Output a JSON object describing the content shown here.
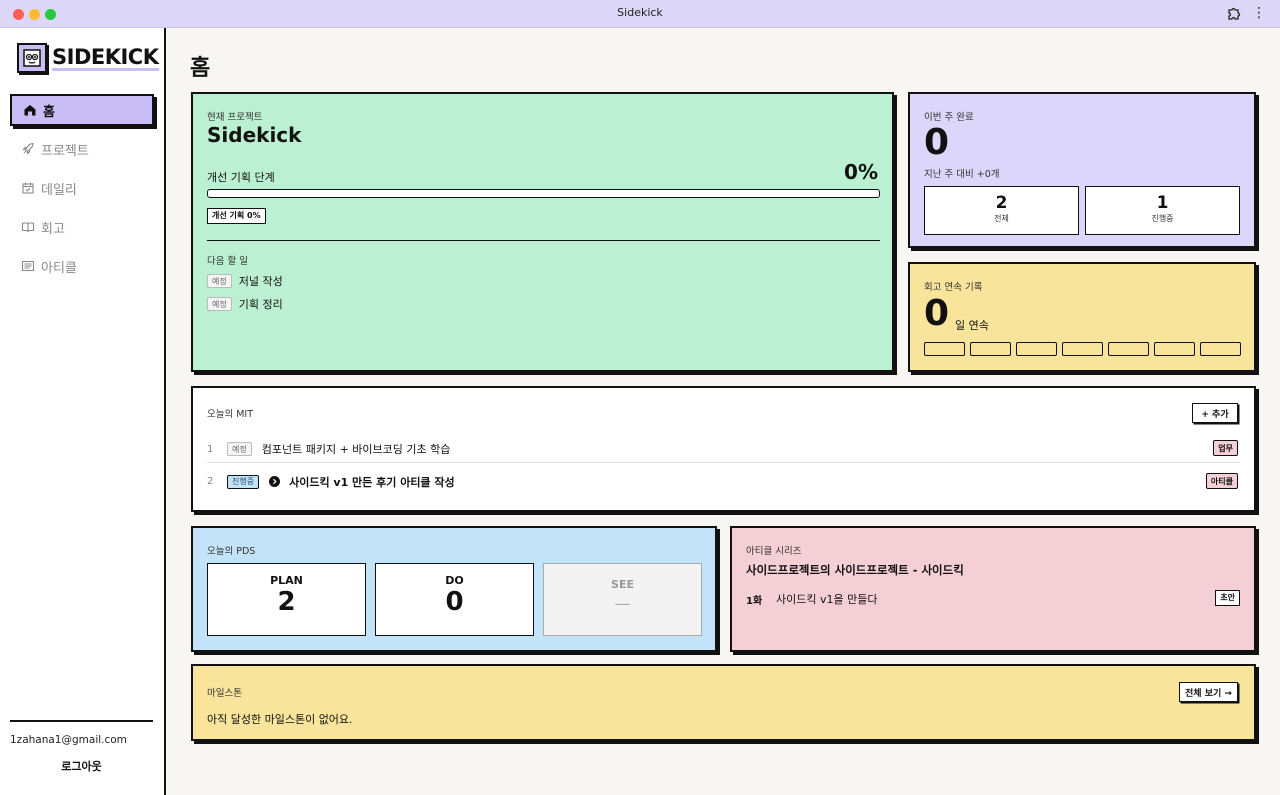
{
  "window": {
    "title": "Sidekick"
  },
  "sidebar": {
    "logo_text": "SIDEKICK",
    "items": [
      {
        "label": "홈",
        "icon": "home-icon",
        "active": true
      },
      {
        "label": "프로젝트",
        "icon": "rocket-icon",
        "active": false
      },
      {
        "label": "데일리",
        "icon": "calendar-icon",
        "active": false
      },
      {
        "label": "회고",
        "icon": "book-icon",
        "active": false
      },
      {
        "label": "아티클",
        "icon": "article-icon",
        "active": false
      }
    ],
    "email": "1zahana1@gmail.com",
    "logout_label": "로그아웃"
  },
  "main": {
    "page_title": "홈",
    "project": {
      "section_label": "현재 프로젝트",
      "name": "Sidekick",
      "stage_label": "개선 기획 단계",
      "progress_text": "0%",
      "progress": 0,
      "stage_chip": "개선 기획 0%",
      "next_label": "다음 할 일",
      "tasks": [
        {
          "tag": "예정",
          "title": "저널 작성"
        },
        {
          "tag": "예정",
          "title": "기획 정리"
        }
      ]
    },
    "weekly": {
      "section_label": "이번 주 완료",
      "count": "0",
      "compare": "지난 주 대비 +0개",
      "total_value": "2",
      "total_label": "전체",
      "progress_value": "1",
      "progress_label": "진행중"
    },
    "streak": {
      "section_label": "회고 연속 기록",
      "count": "0",
      "unit": "일 연속",
      "days": 7
    },
    "mit": {
      "section_label": "오늘의 MIT",
      "add_label": "+ 추가",
      "items": [
        {
          "num": "1",
          "tag": "예정",
          "title": "컴포넌트 패키지 + 바이브코딩 기초 학습",
          "category": "업무"
        },
        {
          "num": "2",
          "tag": "진행중",
          "title": "사이드킥 v1 만든 후기 아티클 작성",
          "category": "아티클"
        }
      ]
    },
    "pds": {
      "section_label": "오늘의 PDS",
      "plan_label": "PLAN",
      "plan_value": "2",
      "do_label": "DO",
      "do_value": "0",
      "see_label": "SEE",
      "see_value": "—"
    },
    "article_series": {
      "section_label": "아티클 시리즈",
      "title": "사이드프로젝트의 사이드프로젝트 - 사이드킥",
      "episode_num": "1화",
      "episode_title": "사이드킥 v1을 만들다",
      "status": "초안"
    },
    "milestone": {
      "section_label": "마일스톤",
      "view_all": "전체 보기 →",
      "empty_text": "아직 달성한 마일스톤이 없어요."
    }
  },
  "colors": {
    "accent_purple": "#c8bdf5",
    "green_card": "#bbf0d2",
    "purple_card": "#dcd6fa",
    "yellow_card": "#f8e49b",
    "blue_card": "#c3e3f8",
    "pink_card": "#f5cfd6"
  }
}
